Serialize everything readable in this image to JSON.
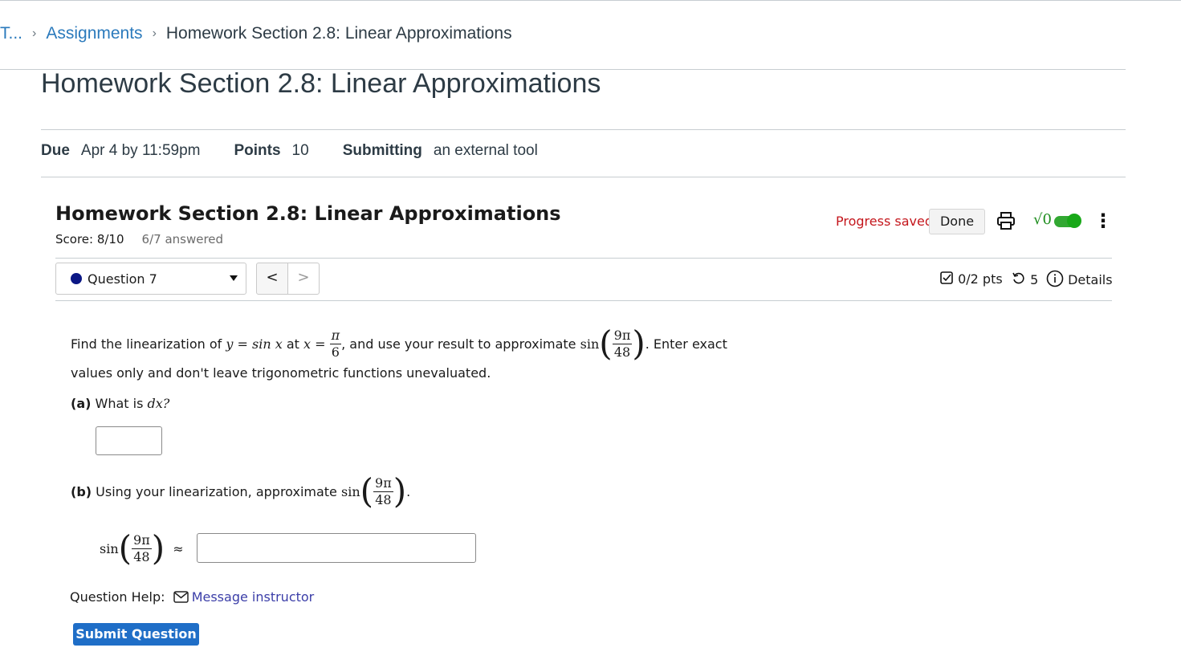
{
  "breadcrumb": {
    "truncated": "T...",
    "link": "Assignments",
    "current": "Homework Section 2.8: Linear Approximations"
  },
  "assignment": {
    "title": "Homework Section 2.8: Linear Approximations",
    "due_label": "Due",
    "due_value": "Apr 4 by 11:59pm",
    "points_label": "Points",
    "points_value": "10",
    "submitting_label": "Submitting",
    "submitting_value": "an external tool"
  },
  "tool": {
    "title": "Homework Section 2.8: Linear Approximations",
    "score": "Score: 8/10",
    "answered": "6/7 answered",
    "progress_saved": "Progress saved",
    "done_label": "Done",
    "math_toggle_label": "√0",
    "question_select": "Question 7",
    "prev": "<",
    "next": ">",
    "pts": "0/2 pts",
    "attempts": "5",
    "details": "Details"
  },
  "question": {
    "intro_1": "Find the linearization of",
    "y_eq": "y = sin x",
    "at": "at",
    "x_eq": "x =",
    "pi_num": "π",
    "pi_den": "6",
    "intro_2": ", and use your result to approximate",
    "sin": "sin",
    "frac_num": "9π",
    "frac_den": "48",
    "intro_3": ". Enter exact",
    "intro_4": "values only and don't leave trigonometric functions unevaluated.",
    "part_a_label": "(a)",
    "part_a_text": "What is",
    "part_a_math": "dx?",
    "part_a_value": "",
    "part_b_label": "(b)",
    "part_b_text": "Using your linearization, approximate",
    "approx": "≈",
    "part_b_value": ""
  },
  "help": {
    "label": "Question Help:",
    "link": "Message instructor"
  },
  "submit_label": "Submit Question",
  "colors": {
    "link": "#2b7abc",
    "progress": "#c4161c",
    "submit": "#1f6ec7",
    "toggle": "#32a832"
  }
}
